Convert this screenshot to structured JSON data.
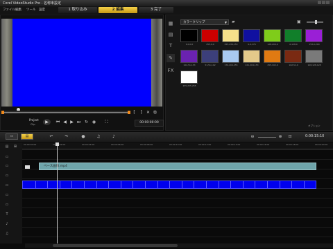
{
  "window": {
    "title": "Corel VideoStudio Pro - 名称未設定"
  },
  "menu": [
    "ファイル",
    "編集",
    "ツール",
    "設定"
  ],
  "steps": [
    {
      "label": "1 取り込み",
      "active": false
    },
    {
      "label": "2 編集",
      "active": true
    },
    {
      "label": "3 完了",
      "active": false
    }
  ],
  "player": {
    "mode_label": "Project",
    "clip_label": "Clip",
    "timecode": "00:00:00:00"
  },
  "library": {
    "category_dropdown": "カラークリップ",
    "footer": "オプション",
    "colors": [
      {
        "hex": "#000000",
        "label": "0,0,0,0"
      },
      {
        "hex": "#cc0000",
        "label": "255,0,0"
      },
      {
        "hex": "#f5e08a",
        "label": "255,239,153"
      },
      {
        "hex": "#1010a0",
        "label": "0,0,176"
      },
      {
        "hex": "#7fcc1a",
        "label": "128,204,0"
      },
      {
        "hex": "#117f2a",
        "label": "0,128,0"
      },
      {
        "hex": "#9a1fd6",
        "label": "153,0,204"
      },
      {
        "hex": "#6a22b0",
        "label": "102,51,153"
      },
      {
        "hex": "#3c3f7a",
        "label": "51,51,102"
      },
      {
        "hex": "#a9c9f0",
        "label": "170,204,255"
      },
      {
        "hex": "#e3c98a",
        "label": "221,204,153"
      },
      {
        "hex": "#e07a12",
        "label": "255,102,0"
      },
      {
        "hex": "#7a2a12",
        "label": "102,51,0"
      },
      {
        "hex": "#7a7a7a",
        "label": "128,128,128"
      },
      {
        "hex": "#ffffff",
        "label": "255,255,255"
      }
    ]
  },
  "timeline": {
    "timecode": "0:00:15:10",
    "ruler": [
      "00:00:00:00",
      "00:00:02:00",
      "00:00:04:00",
      "00:00:06:00",
      "00:00:08:00",
      "00:00:10:00",
      "00:00:12:00",
      "00:00:14:00",
      "00:00:16:00",
      "00:00:18:00",
      "00:00:20:00"
    ],
    "overlay_clip": "ベース画像.mp4"
  }
}
